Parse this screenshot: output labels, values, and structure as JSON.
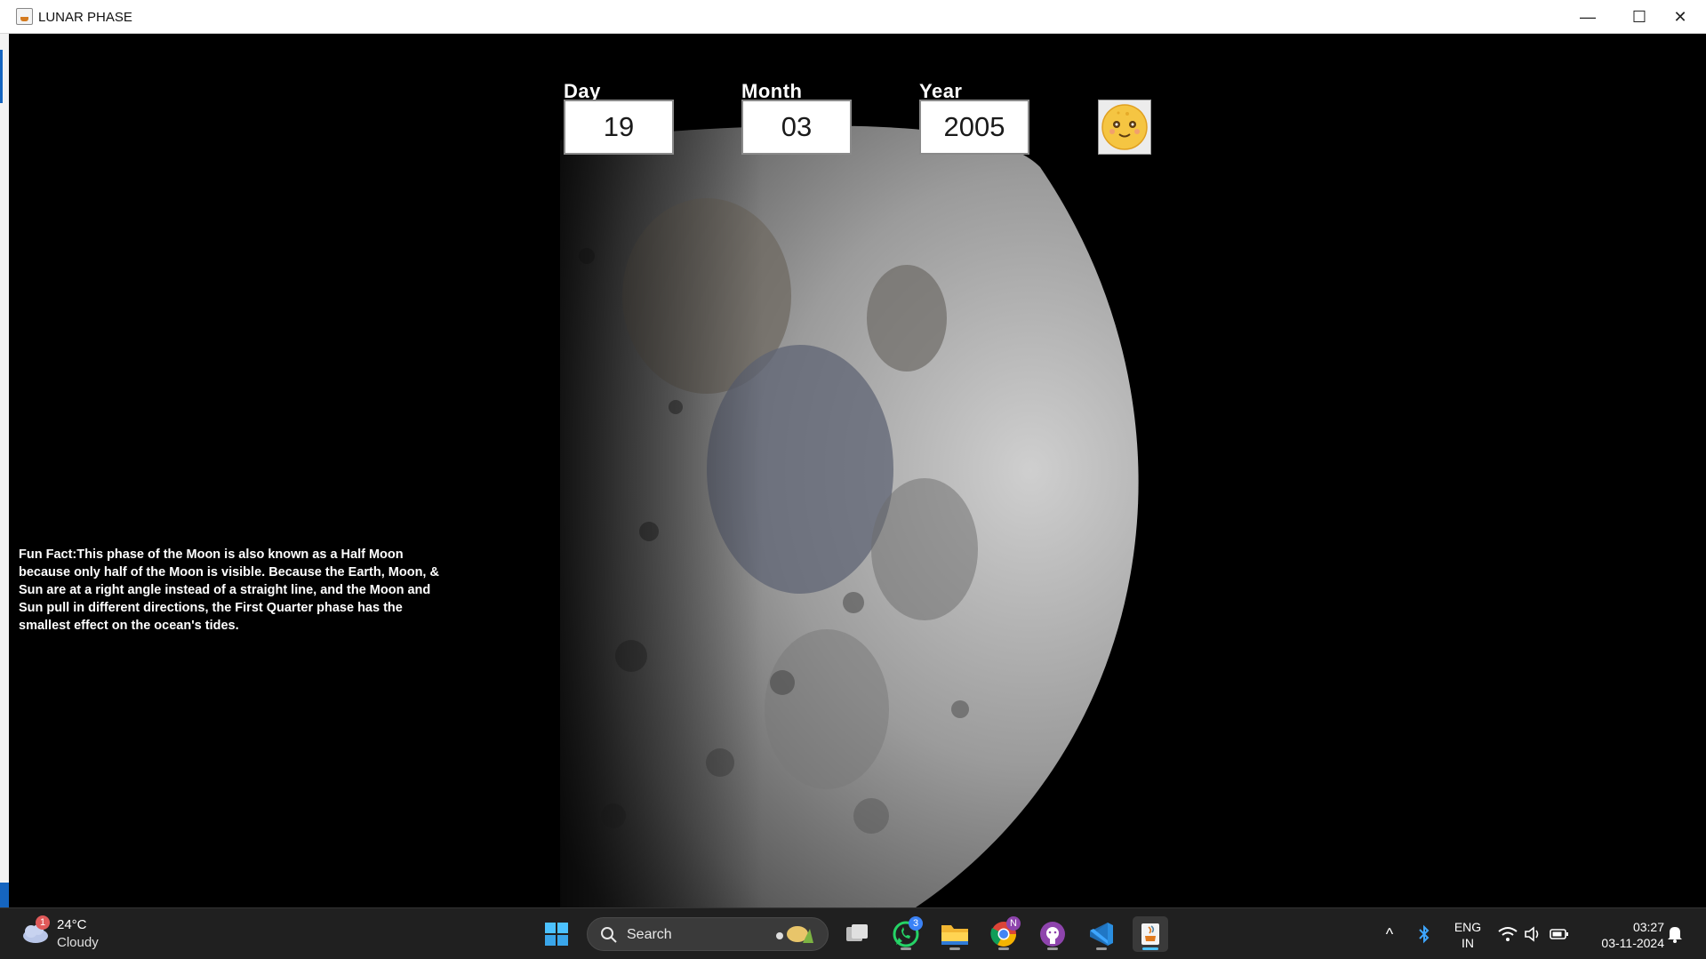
{
  "window": {
    "title": "LUNAR PHASE",
    "minimize_glyph": "—",
    "maximize_glyph": "☐",
    "close_glyph": "✕"
  },
  "form": {
    "day_label": "Day",
    "day_value": "19",
    "month_label": "Month",
    "month_value": "03",
    "year_label": "Year",
    "year_value": "2005",
    "emoji_icon": "sun-face-icon"
  },
  "fun_fact": "Fun Fact:This phase of the Moon is also known as a Half Moon because only half of the Moon is visible. Because the Earth, Moon, & Sun are at a right angle instead of a straight line, and the Moon and Sun pull in different directions, the First Quarter phase has the smallest effect on the ocean's tides.",
  "taskbar": {
    "weather": {
      "temp": "24°C",
      "condition": "Cloudy",
      "badge": "1"
    },
    "search_placeholder": "Search",
    "whatsapp_badge": "3",
    "chrome_badge": "N",
    "apps": [
      "windows-start-icon",
      "search-icon",
      "task-view-icon",
      "whatsapp-icon",
      "file-explorer-icon",
      "chrome-icon",
      "github-icon",
      "vscode-icon",
      "java-icon"
    ],
    "tray": {
      "chevron": "^",
      "lang_line1": "ENG",
      "lang_line2": "IN"
    },
    "clock": {
      "time": "03:27",
      "date": "03-11-2024"
    }
  },
  "colors": {
    "titlebar_bg": "#ffffff",
    "app_bg": "#000000",
    "taskbar_bg": "#202020",
    "accent": "#1565c0"
  }
}
